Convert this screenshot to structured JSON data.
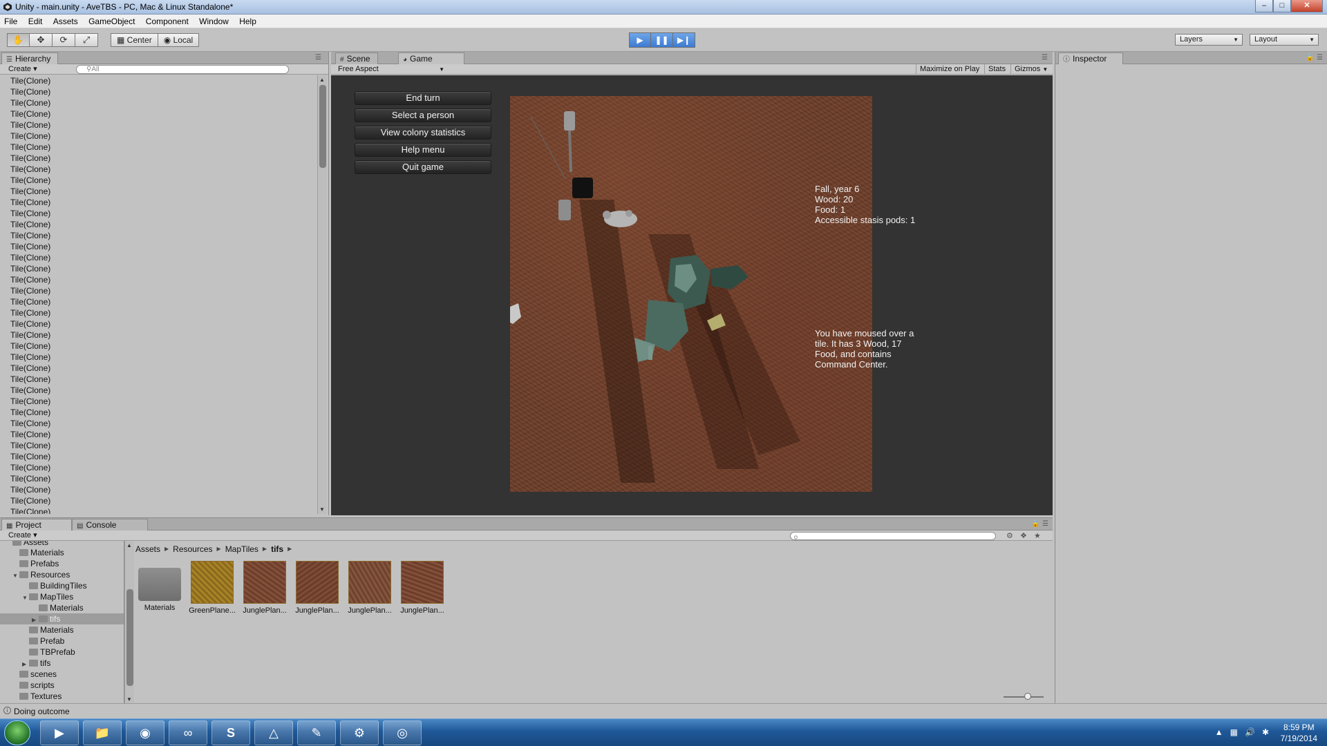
{
  "window": {
    "title": "Unity - main.unity - AveTBS - PC, Mac & Linux Standalone*"
  },
  "menu": [
    "File",
    "Edit",
    "Assets",
    "GameObject",
    "Component",
    "Window",
    "Help"
  ],
  "toolbar": {
    "tools": [
      "hand-icon",
      "move-icon",
      "rotate-icon",
      "scale-icon"
    ],
    "pivot_center": "Center",
    "pivot_local": "Local",
    "layers_label": "Layers",
    "layout_label": "Layout"
  },
  "hierarchy": {
    "tab": "Hierarchy",
    "create_label": "Create",
    "search_placeholder": "All",
    "rows": [
      "Tile(Clone)",
      "Tile(Clone)",
      "Tile(Clone)",
      "Tile(Clone)",
      "Tile(Clone)",
      "Tile(Clone)",
      "Tile(Clone)",
      "Tile(Clone)",
      "Tile(Clone)",
      "Tile(Clone)",
      "Tile(Clone)",
      "Tile(Clone)",
      "Tile(Clone)",
      "Tile(Clone)",
      "Tile(Clone)",
      "Tile(Clone)",
      "Tile(Clone)",
      "Tile(Clone)",
      "Tile(Clone)",
      "Tile(Clone)",
      "Tile(Clone)",
      "Tile(Clone)",
      "Tile(Clone)",
      "Tile(Clone)",
      "Tile(Clone)",
      "Tile(Clone)",
      "Tile(Clone)",
      "Tile(Clone)",
      "Tile(Clone)",
      "Tile(Clone)",
      "Tile(Clone)",
      "Tile(Clone)",
      "Tile(Clone)",
      "Tile(Clone)",
      "Tile(Clone)",
      "Tile(Clone)",
      "Tile(Clone)",
      "Tile(Clone)",
      "Tile(Clone)",
      "Tile(Clone)"
    ]
  },
  "gameview": {
    "tab_scene": "Scene",
    "tab_game": "Game",
    "aspect": "Free Aspect",
    "maximize_label": "Maximize on Play",
    "stats_label": "Stats",
    "gizmos_label": "Gizmos",
    "buttons": {
      "end_turn": "End turn",
      "select_person": "Select a person",
      "view_stats": "View colony statistics",
      "help_menu": "Help menu",
      "quit_game": "Quit game"
    },
    "status_text": "Fall, year 6\nWood: 20\nFood: 1\nAccessible stasis pods: 1",
    "mouseover_text": "You have moused over a\ntile. It has 3 Wood, 17\nFood, and contains\nCommand Center."
  },
  "inspector": {
    "tab": "Inspector"
  },
  "project": {
    "tab_project": "Project",
    "tab_console": "Console",
    "create_label": "Create",
    "tree": {
      "assets": "Assets",
      "materials": "Materials",
      "prefabs": "Prefabs",
      "resources": "Resources",
      "building_tiles": "BuildingTiles",
      "map_tiles": "MapTiles",
      "map_materials": "Materials",
      "map_tifs": "tifs",
      "res_materials": "Materials",
      "prefab": "Prefab",
      "tbprefab": "TBPrefab",
      "res_tifs": "tifs",
      "scenes": "scenes",
      "scripts": "scripts",
      "textures": "Textures"
    },
    "breadcrumb": [
      "Assets",
      "Resources",
      "MapTiles",
      "tifs"
    ],
    "assets": [
      {
        "label": "Materials",
        "kind": "folder"
      },
      {
        "label": "GreenPlane...",
        "kind": "green"
      },
      {
        "label": "JunglePlan...",
        "kind": "jungle"
      },
      {
        "label": "JunglePlan...",
        "kind": "jungle"
      },
      {
        "label": "JunglePlan...",
        "kind": "jungle"
      },
      {
        "label": "JunglePlan...",
        "kind": "jungle"
      }
    ]
  },
  "status_bar": {
    "message": "Doing outcome"
  },
  "taskbar": {
    "time": "8:59 PM",
    "date": "7/19/2014"
  }
}
